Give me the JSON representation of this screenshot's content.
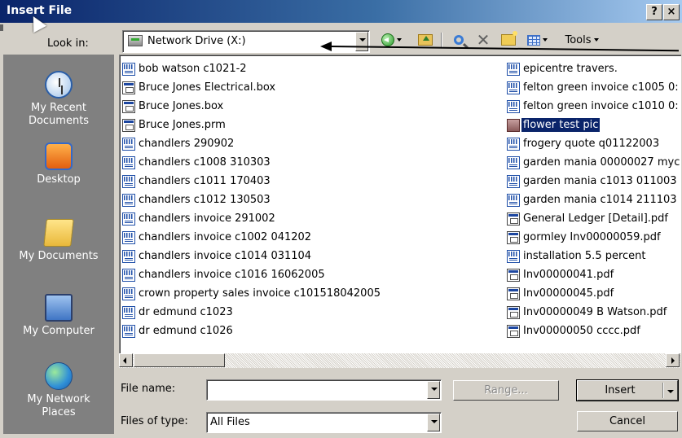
{
  "window": {
    "title": "Insert File",
    "help_btn": "?",
    "close_btn": "×"
  },
  "toolbar": {
    "look_in_label": "Look in:",
    "look_in_value": "Network Drive (X:)",
    "tools_label": "Tools",
    "icons": [
      "drive-icon",
      "back-icon",
      "up-folder-icon",
      "search-web-icon",
      "delete-icon",
      "new-folder-icon",
      "views-icon"
    ]
  },
  "places": [
    {
      "label": "My Recent Documents",
      "icon": "recent-documents-icon"
    },
    {
      "label": "Desktop",
      "icon": "desktop-icon"
    },
    {
      "label": "My Documents",
      "icon": "my-documents-icon"
    },
    {
      "label": "My Computer",
      "icon": "my-computer-icon"
    },
    {
      "label": "My Network Places",
      "icon": "network-places-icon"
    }
  ],
  "files_left": [
    {
      "name": "bob watson c1021-2",
      "icon": "word"
    },
    {
      "name": "Bruce Jones Electrical.box",
      "icon": "generic"
    },
    {
      "name": "Bruce Jones.box",
      "icon": "generic"
    },
    {
      "name": "Bruce Jones.prm",
      "icon": "generic"
    },
    {
      "name": "chandlers 290902",
      "icon": "word"
    },
    {
      "name": "chandlers c1008 310303",
      "icon": "word"
    },
    {
      "name": "chandlers c1011 170403",
      "icon": "word"
    },
    {
      "name": "chandlers c1012 130503",
      "icon": "word"
    },
    {
      "name": "chandlers invoice 291002",
      "icon": "word"
    },
    {
      "name": "chandlers invoice c1002 041202",
      "icon": "word"
    },
    {
      "name": "chandlers invoice c1014 031104",
      "icon": "word"
    },
    {
      "name": "chandlers invoice c1016 16062005",
      "icon": "word"
    },
    {
      "name": "crown property sales invoice c101518042005",
      "icon": "word"
    },
    {
      "name": "dr edmund c1023",
      "icon": "word"
    },
    {
      "name": "dr edmund c1026",
      "icon": "word"
    }
  ],
  "files_right": [
    {
      "name": "epicentre travers.",
      "icon": "word"
    },
    {
      "name": "felton green invoice c1005 0:",
      "icon": "word"
    },
    {
      "name": "felton green invoice c1010 0:",
      "icon": "word"
    },
    {
      "name": "flower test pic",
      "icon": "image",
      "selected": true
    },
    {
      "name": "frogery quote q01122003",
      "icon": "word"
    },
    {
      "name": "garden mania 00000027 myc",
      "icon": "word"
    },
    {
      "name": "garden mania c1013 011003",
      "icon": "word"
    },
    {
      "name": "garden mania c1014 211103",
      "icon": "word"
    },
    {
      "name": "General Ledger [Detail].pdf",
      "icon": "generic"
    },
    {
      "name": "gormley Inv00000059.pdf",
      "icon": "generic"
    },
    {
      "name": "installation 5.5 percent",
      "icon": "word"
    },
    {
      "name": "Inv00000041.pdf",
      "icon": "generic"
    },
    {
      "name": "Inv00000045.pdf",
      "icon": "generic"
    },
    {
      "name": "Inv00000049 B Watson.pdf",
      "icon": "generic"
    },
    {
      "name": "Inv00000050 cccc.pdf",
      "icon": "generic"
    }
  ],
  "bottom": {
    "file_name_label": "File name:",
    "file_name_value": "",
    "file_type_label": "Files of type:",
    "file_type_value": "All Files",
    "range_label": "Range...",
    "insert_label": "Insert",
    "cancel_label": "Cancel"
  },
  "colors": {
    "title_bar": "#0a246a",
    "selection": "#0a246a",
    "face": "#d4d0c8",
    "places_bar": "#808080"
  }
}
